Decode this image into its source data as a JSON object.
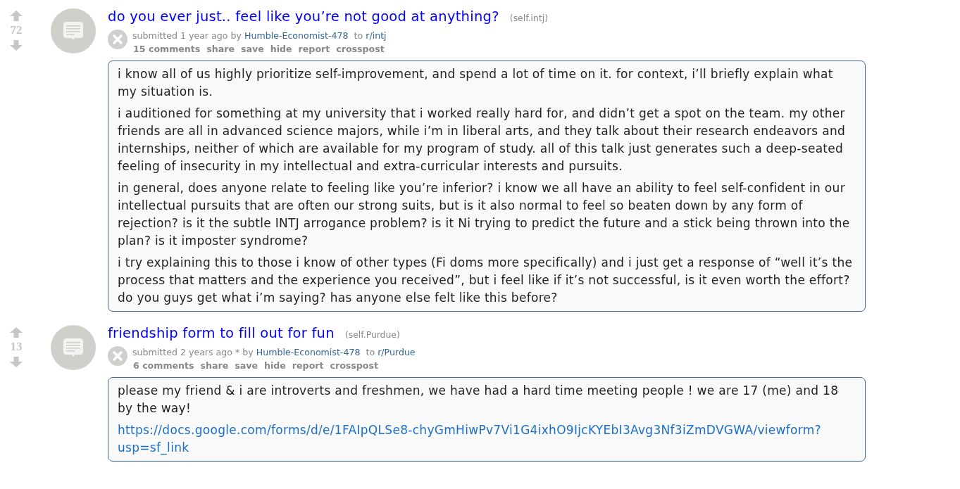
{
  "posts": [
    {
      "score": "72",
      "title": "do you ever just.. feel like you’re not good at anything?",
      "domain": "(self.intj)",
      "tagline": {
        "submitted_label": "submitted",
        "time": "1 year ago",
        "by_label": "by",
        "author": "Humble-Economist-478",
        "to_label": "to",
        "subreddit": "r/intj"
      },
      "actions": [
        "15 comments",
        "share",
        "save",
        "hide",
        "report",
        "crosspost"
      ],
      "body": [
        {
          "kind": "text",
          "text": "i know all of us highly prioritize self-improvement, and spend a lot of time on it. for context, i’ll briefly explain what my situation is."
        },
        {
          "kind": "text",
          "text": "i auditioned for something at my university that i worked really hard for, and didn’t get a spot on the team. my other friends are all in advanced science majors, while i’m in liberal arts, and they talk about their research endeavors and internships, neither of which are available for my program of study. all of this talk just generates such a deep-seated feeling of insecurity in my intellectual and extra-curricular interests and pursuits."
        },
        {
          "kind": "text",
          "text": "in general, does anyone relate to feeling like you’re inferior? i know we all have an ability to feel self-confident in our intellectual pursuits that are often our strong suits, but is it also normal to feel so beaten down by any form of rejection? is it the subtle INTJ arrogance problem? is it Ni trying to predict the future and a stick being thrown into the plan? is it imposter syndrome?"
        },
        {
          "kind": "text",
          "text": "i try explaining this to those i know of other types (Fi doms more specifically) and i just get a response of “well it’s the process that matters and the experience you received”, but i feel like if it’s not successful, is it even worth the effort? do you guys get what i’m saying? has anyone else felt like this before?"
        }
      ]
    },
    {
      "score": "13",
      "title": "friendship form to fill out for fun",
      "domain": "(self.Purdue)",
      "tagline": {
        "submitted_label": "submitted",
        "time": "2 years ago",
        "edited_mark": "*",
        "by_label": "by",
        "author": "Humble-Economist-478",
        "to_label": "to",
        "subreddit": "r/Purdue"
      },
      "actions": [
        "6 comments",
        "share",
        "save",
        "hide",
        "report",
        "crosspost"
      ],
      "body": [
        {
          "kind": "text",
          "text": "please my friend & i are introverts and freshmen, we have had a hard time meeting people ! we are 17 (me) and 18 by the way!"
        },
        {
          "kind": "link",
          "text": "https://docs.google.com/forms/d/e/1FAIpQLSe8-chyGmHiwPv7Vi1G4ixhO9IjcKYEbI3Avg3Nf3iZmDVGWA/viewform?usp=sf_link"
        }
      ]
    }
  ]
}
